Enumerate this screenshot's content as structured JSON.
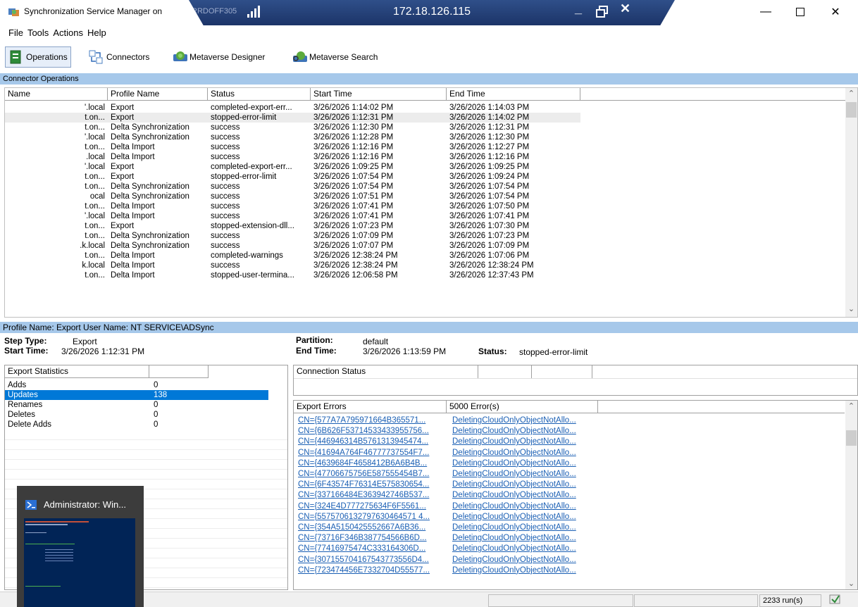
{
  "window": {
    "title": "Synchronization Service Manager on",
    "rdp_host": "172.18.126.115",
    "rdp_prefix": "RRDOFF305"
  },
  "menu": [
    "File",
    "Tools",
    "Actions",
    "Help"
  ],
  "toolbar": {
    "operations": "Operations",
    "connectors": "Connectors",
    "mv_designer": "Metaverse Designer",
    "mv_search": "Metaverse Search"
  },
  "ops": {
    "section_title": "Connector Operations",
    "columns": [
      "Name",
      "Profile Name",
      "Status",
      "Start Time",
      "End Time"
    ],
    "rows": [
      {
        "name": "'.local",
        "profile": "Export",
        "status": "completed-export-err...",
        "start": "3/26/2026 1:14:02 PM",
        "end": "3/26/2026 1:14:03 PM"
      },
      {
        "name": "t.on...",
        "profile": "Export",
        "status": "stopped-error-limit",
        "start": "3/26/2026 1:12:31 PM",
        "end": "3/26/2026 1:14:02 PM"
      },
      {
        "name": "t.on...",
        "profile": "Delta Synchronization",
        "status": "success",
        "start": "3/26/2026 1:12:30 PM",
        "end": "3/26/2026 1:12:31 PM"
      },
      {
        "name": "'.local",
        "profile": "Delta Synchronization",
        "status": "success",
        "start": "3/26/2026 1:12:28 PM",
        "end": "3/26/2026 1:12:30 PM"
      },
      {
        "name": "t.on...",
        "profile": "Delta Import",
        "status": "success",
        "start": "3/26/2026 1:12:16 PM",
        "end": "3/26/2026 1:12:27 PM"
      },
      {
        "name": ".local",
        "profile": "Delta Import",
        "status": "success",
        "start": "3/26/2026 1:12:16 PM",
        "end": "3/26/2026 1:12:16 PM"
      },
      {
        "name": "'.local",
        "profile": "Export",
        "status": "completed-export-err...",
        "start": "3/26/2026 1:09:25 PM",
        "end": "3/26/2026 1:09:25 PM"
      },
      {
        "name": "t.on...",
        "profile": "Export",
        "status": "stopped-error-limit",
        "start": "3/26/2026 1:07:54 PM",
        "end": "3/26/2026 1:09:24 PM"
      },
      {
        "name": "t.on...",
        "profile": "Delta Synchronization",
        "status": "success",
        "start": "3/26/2026 1:07:54 PM",
        "end": "3/26/2026 1:07:54 PM"
      },
      {
        "name": "ocal",
        "profile": "Delta Synchronization",
        "status": "success",
        "start": "3/26/2026 1:07:51 PM",
        "end": "3/26/2026 1:07:54 PM"
      },
      {
        "name": "t.on...",
        "profile": "Delta Import",
        "status": "success",
        "start": "3/26/2026 1:07:41 PM",
        "end": "3/26/2026 1:07:50 PM"
      },
      {
        "name": "'.local",
        "profile": "Delta Import",
        "status": "success",
        "start": "3/26/2026 1:07:41 PM",
        "end": "3/26/2026 1:07:41 PM"
      },
      {
        "name": "t.on...",
        "profile": "Export",
        "status": "stopped-extension-dll...",
        "start": "3/26/2026 1:07:23 PM",
        "end": "3/26/2026 1:07:30 PM"
      },
      {
        "name": "t.on...",
        "profile": "Delta Synchronization",
        "status": "success",
        "start": "3/26/2026 1:07:09 PM",
        "end": "3/26/2026 1:07:23 PM"
      },
      {
        "name": ".k.local",
        "profile": "Delta Synchronization",
        "status": "success",
        "start": "3/26/2026 1:07:07 PM",
        "end": "3/26/2026 1:07:09 PM"
      },
      {
        "name": "t.on...",
        "profile": "Delta Import",
        "status": "completed-warnings",
        "start": "3/26/2026 12:38:24 PM",
        "end": "3/26/2026 1:07:06 PM"
      },
      {
        "name": "k.local",
        "profile": "Delta Import",
        "status": "success",
        "start": "3/26/2026 12:38:24 PM",
        "end": "3/26/2026 12:38:24 PM"
      },
      {
        "name": "t.on...",
        "profile": "Delta Import",
        "status": "stopped-user-termina...",
        "start": "3/26/2026 12:06:58 PM",
        "end": "3/26/2026 12:37:43 PM"
      }
    ]
  },
  "detail": {
    "header": "Profile Name: Export  User Name: NT SERVICE\\ADSync",
    "step_type_label": "Step Type:",
    "step_type": "Export",
    "start_time_label": "Start Time:",
    "start_time": "3/26/2026 1:12:31 PM",
    "partition_label": "Partition:",
    "partition": "default",
    "end_time_label": "End Time:",
    "end_time": "3/26/2026 1:13:59 PM",
    "status_label": "Status:",
    "status": "stopped-error-limit"
  },
  "export_stats": {
    "title": "Export Statistics",
    "rows": [
      {
        "label": "Adds",
        "value": "0"
      },
      {
        "label": "Updates",
        "value": "138"
      },
      {
        "label": "Renames",
        "value": "0"
      },
      {
        "label": "Deletes",
        "value": "0"
      },
      {
        "label": "Delete Adds",
        "value": "0"
      }
    ]
  },
  "connection_status": {
    "title": "Connection Status"
  },
  "export_errors": {
    "title": "Export Errors",
    "count": "5000 Error(s)",
    "rows": [
      {
        "dn": "CN={577A7A795971664B365571...",
        "error": "DeletingCloudOnlyObjectNotAllo..."
      },
      {
        "dn": "CN={6B626F53714533433955756...",
        "error": "DeletingCloudOnlyObjectNotAllo..."
      },
      {
        "dn": "CN={446946314B5761313945474...",
        "error": "DeletingCloudOnlyObjectNotAllo..."
      },
      {
        "dn": "CN={41694A764F46777737554F7...",
        "error": "DeletingCloudOnlyObjectNotAllo..."
      },
      {
        "dn": "CN={4639684F4658412B6A6B4B...",
        "error": "DeletingCloudOnlyObjectNotAllo..."
      },
      {
        "dn": "CN={47706675756E587555454B7...",
        "error": "DeletingCloudOnlyObjectNotAllo..."
      },
      {
        "dn": "CN={6F43574F76314E575830654...",
        "error": "DeletingCloudOnlyObjectNotAllo..."
      },
      {
        "dn": "CN={337166484E363942746B537...",
        "error": "DeletingCloudOnlyObjectNotAllo..."
      },
      {
        "dn": "CN={324E4D777275634F6F5561...",
        "error": "DeletingCloudOnlyObjectNotAllo..."
      },
      {
        "dn": "CN={5575706132797630464571 4...",
        "error": "DeletingCloudOnlyObjectNotAllo..."
      },
      {
        "dn": "CN={354A5150425552667A6B36...",
        "error": "DeletingCloudOnlyObjectNotAllo..."
      },
      {
        "dn": "CN={73716F346B387754566B6D...",
        "error": "DeletingCloudOnlyObjectNotAllo..."
      },
      {
        "dn": "CN={77416975474C333164306D...",
        "error": "DeletingCloudOnlyObjectNotAllo..."
      },
      {
        "dn": "CN={307155704167543773556D4...",
        "error": "DeletingCloudOnlyObjectNotAllo..."
      },
      {
        "dn": "CN={723474456E7332704D55577...",
        "error": "DeletingCloudOnlyObjectNotAllo..."
      }
    ]
  },
  "taskbar_thumb": {
    "title": "Administrator: Win..."
  },
  "statusbar": {
    "runs": "2233 run(s)"
  },
  "colors": {
    "section_bg": "#a6c8ea",
    "selection": "#0078d7",
    "link": "#1a5fb4",
    "rdp_bar": "#1c3468"
  }
}
